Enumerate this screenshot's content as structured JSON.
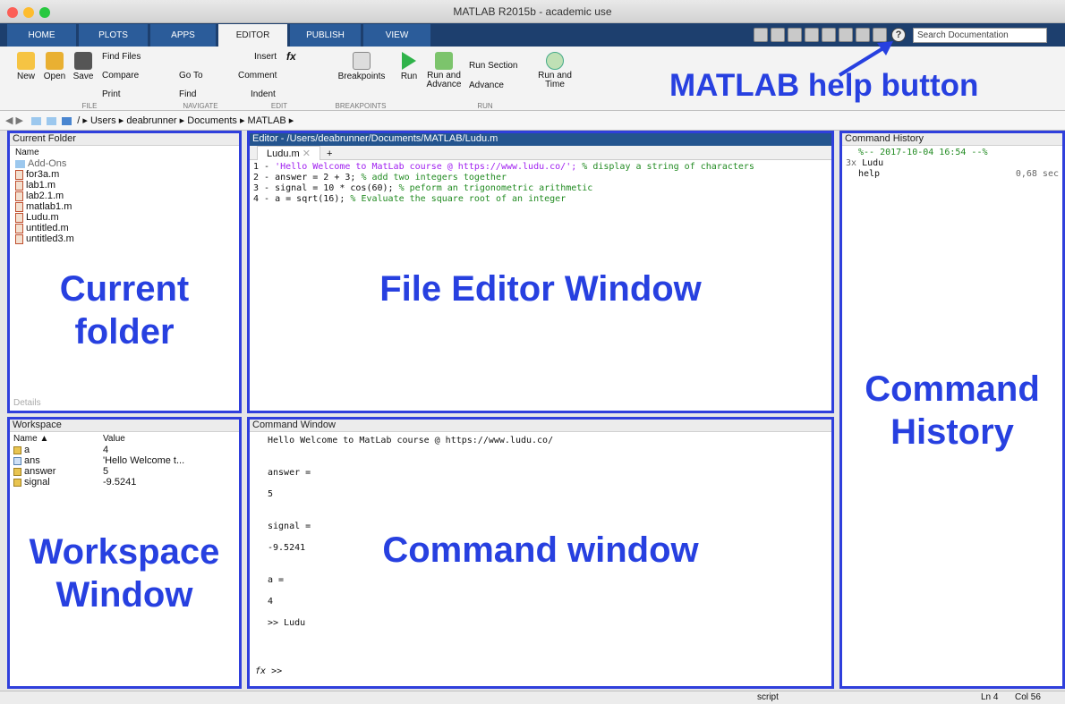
{
  "window": {
    "title": "MATLAB R2015b - academic use"
  },
  "tabs": [
    "HOME",
    "PLOTS",
    "APPS",
    "EDITOR",
    "PUBLISH",
    "VIEW"
  ],
  "search": {
    "placeholder": "Search Documentation"
  },
  "ribbon": {
    "file": {
      "new": "New",
      "open": "Open",
      "save": "Save",
      "find_files": "Find Files",
      "compare": "Compare",
      "print": "Print",
      "label": "FILE"
    },
    "navigate": {
      "goto": "Go To",
      "find": "Find",
      "label": "NAVIGATE"
    },
    "edit": {
      "insert": "Insert",
      "comment": "Comment",
      "indent": "Indent",
      "label": "EDIT"
    },
    "breakpoints": {
      "button": "Breakpoints",
      "label": "BREAKPOINTS"
    },
    "run": {
      "run": "Run",
      "run_advance": "Run and Advance",
      "run_section": "Run Section",
      "advance": "Advance",
      "run_time": "Run and Time",
      "label": "RUN"
    }
  },
  "path": [
    "/",
    "Users",
    "deabrunner",
    "Documents",
    "MATLAB"
  ],
  "current_folder": {
    "title": "Current Folder",
    "column": "Name",
    "files": [
      "Add-Ons",
      "for3a.m",
      "lab1.m",
      "lab2.1.m",
      "matlab1.m",
      "Ludu.m",
      "untitled.m",
      "untitled3.m"
    ],
    "details": "Details"
  },
  "editor": {
    "title": "Editor - /Users/deabrunner/Documents/MATLAB/Ludu.m",
    "tab": "Ludu.m",
    "lines": [
      {
        "num": "1 -",
        "code": "'Hello Welcome to MatLab course @ https://www.ludu.co/';",
        "comment": "% display a string of characters"
      },
      {
        "num": "2 -",
        "code": "answer = 2 + 3;",
        "comment": "% add two integers together"
      },
      {
        "num": "3 -",
        "code": "signal = 10 * cos(60);",
        "comment": "% peform an trigonometric arithmetic"
      },
      {
        "num": "4 -",
        "code": "a = sqrt(16);",
        "comment": "% Evaluate the square root of an integer"
      }
    ]
  },
  "history": {
    "title": "Command History",
    "session": "%-- 2017-10-04 16:54 --%",
    "count": "3x",
    "items": [
      "Ludu",
      "help"
    ],
    "time": "0,68 sec"
  },
  "workspace": {
    "title": "Workspace",
    "col_name": "Name ▲",
    "col_value": "Value",
    "vars": [
      {
        "name": "a",
        "value": "4"
      },
      {
        "name": "ans",
        "value": "'Hello Welcome t..."
      },
      {
        "name": "answer",
        "value": "5"
      },
      {
        "name": "signal",
        "value": "-9.5241"
      }
    ]
  },
  "command": {
    "title": "Command Window",
    "lines": [
      "Hello Welcome to MatLab course @ https://www.ludu.co/",
      "",
      "",
      "answer =",
      "",
      "     5",
      "",
      "",
      "signal =",
      "",
      "   -9.5241",
      "",
      "",
      "a =",
      "",
      "     4",
      "",
      ">> Ludu"
    ],
    "prompt": ">>"
  },
  "annotations": {
    "help": "MATLAB help button",
    "folder": "Current folder",
    "editor": "File Editor Window",
    "history": "Command History",
    "workspace": "Workspace Window",
    "command": "Command window"
  },
  "status": {
    "mode": "script",
    "ln": "Ln  4",
    "col": "Col  56"
  },
  "colors": {
    "annotation": "#2740e0",
    "tab_bar": "#1d3f6e",
    "string": "#a020f0",
    "comment": "#228b22"
  }
}
